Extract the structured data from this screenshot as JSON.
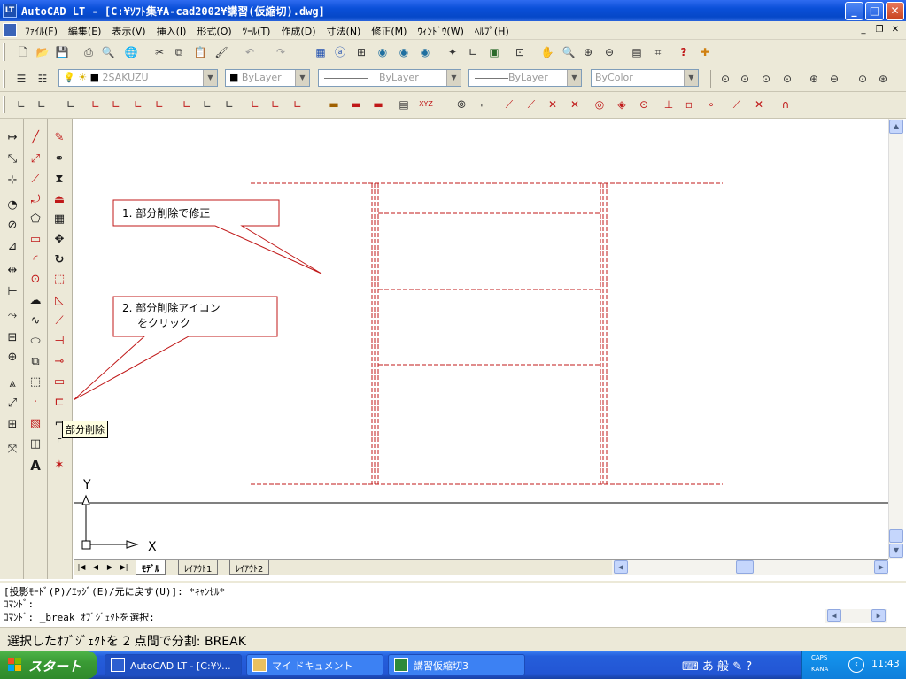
{
  "window": {
    "app_icon_label": "LT",
    "title": "AutoCAD LT - [C:¥ｿﾌﾄ集¥A-cad2002¥講習(仮縮切).dwg]",
    "minimize": "_",
    "maximize": "□",
    "close": "✕"
  },
  "menubar": {
    "items": [
      "ﾌｧｲﾙ(F)",
      "編集(E)",
      "表示(V)",
      "挿入(I)",
      "形式(O)",
      "ﾂｰﾙ(T)",
      "作成(D)",
      "寸法(N)",
      "修正(M)",
      "ｳｨﾝﾄﾞｳ(W)",
      "ﾍﾙﾌﾟ(H)"
    ],
    "mdi_minimize": "_",
    "mdi_restore": "❐",
    "mdi_close": "✕"
  },
  "properties_toolbar": {
    "layer_value": "2SAKUZU",
    "color_value": "ByLayer",
    "linetype_value": "ByLayer",
    "lineweight_value": "ByLayer",
    "plotstyle_value": "ByColor"
  },
  "tooltip": "部分削除",
  "annotations": [
    {
      "text_lines": [
        "1. 部分削除で修正"
      ]
    },
    {
      "text_lines": [
        "2. 部分削除アイコン",
        "をクリック"
      ]
    }
  ],
  "ucs": {
    "x_label": "X",
    "y_label": "Y"
  },
  "tabs": {
    "model": "ﾓﾃﾞﾙ",
    "layout1": "ﾚｲｱｳﾄ1",
    "layout2": "ﾚｲｱｳﾄ2"
  },
  "command_lines": [
    "[投影ﾓｰﾄﾞ(P)/ｴｯｼﾞ(E)/元に戻す(U)]: *ｷｬﾝｾﾙ*",
    "ｺﾏﾝﾄﾞ:",
    "ｺﾏﾝﾄﾞ: _break ｵﾌﾞｼﾞｪｸﾄを選択:"
  ],
  "status_text": "選択したｵﾌﾞｼﾞｪｸﾄを 2 点間で分割: BREAK",
  "taskbar": {
    "start": "スタート",
    "tasks": [
      "AutoCAD LT - [C:¥ｿ...",
      "マイ ドキュメント",
      "講習仮縮切3"
    ],
    "tray_ime": "あ 般",
    "tray_caps": "CAPS",
    "tray_kana": "KANA",
    "clock": "11:43"
  },
  "colors": {
    "accent_red": "#c01818",
    "title_blue": "#0a4fd8",
    "start_green": "#3a9b35"
  }
}
